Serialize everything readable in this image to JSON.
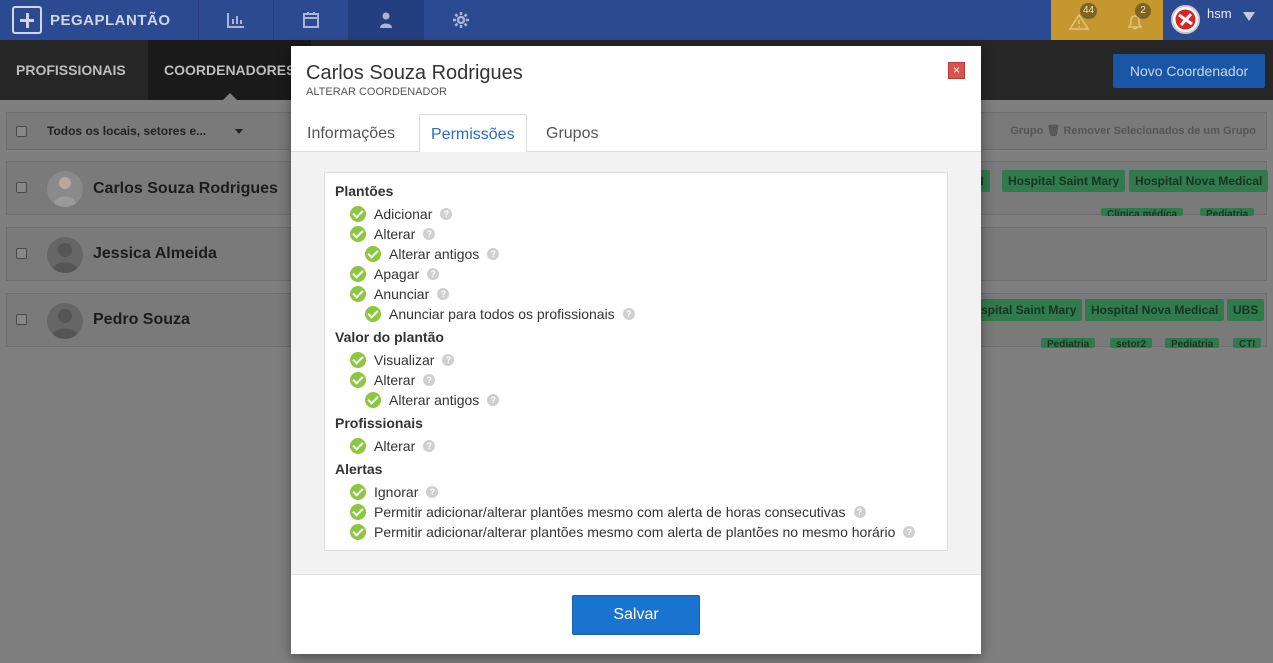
{
  "app": {
    "name": "PEGAPLANTÃO",
    "alerts": [
      {
        "count": "44"
      },
      {
        "count": "2"
      }
    ],
    "user": "hsm"
  },
  "subnav": {
    "tabs": [
      "PROFISSIONAIS",
      "COORDENADORES"
    ],
    "new_button": "Novo Coordenador"
  },
  "list": {
    "filter": "Todos os locais, setores e...",
    "actions": [
      "Grupo",
      "Remover Selecionados de um Grupo"
    ],
    "rows": [
      {
        "name": "Carlos Souza Rodrigues",
        "tags": [
          "TI",
          "Hospital Saint Mary",
          "Hospital Nova Medical"
        ],
        "subtags": [
          "Clínica médica",
          "Pediatria"
        ]
      },
      {
        "name": "Jessica Almeida",
        "tags": [],
        "subtags": []
      },
      {
        "name": "Pedro Souza",
        "tags": [
          "spital Saint Mary",
          "Hospital Nova Medical",
          "UBS"
        ],
        "subtags": [
          "Pediatria",
          "setor2",
          "Pediatria",
          "CTI"
        ]
      }
    ]
  },
  "modal": {
    "title": "Carlos Souza Rodrigues",
    "subtitle": "ALTERAR COORDENADOR",
    "close": "×",
    "tabs": [
      "Informações",
      "Permissões",
      "Grupos"
    ],
    "sections": [
      {
        "label": "Plantões",
        "items": [
          "Adicionar",
          "Alterar",
          "Alterar antigos",
          "Apagar",
          "Anunciar",
          "Anunciar para todos os profissionais"
        ]
      },
      {
        "label": "Valor do plantão",
        "items": [
          "Visualizar",
          "Alterar",
          "Alterar antigos"
        ]
      },
      {
        "label": "Profissionais",
        "items": [
          "Alterar"
        ]
      },
      {
        "label": "Alertas",
        "items": [
          "Ignorar",
          "Permitir adicionar/alterar plantões mesmo com alerta de horas consecutivas",
          "Permitir adicionar/alterar plantões mesmo com alerta de plantões no mesmo horário"
        ]
      }
    ],
    "help": "?",
    "save": "Salvar"
  },
  "colors": {
    "topbar": "#2c4a92",
    "accent": "#1a73d0",
    "check": "#8dc63f",
    "alert_bg": "#c4972f"
  },
  "icons": [
    "chart-icon",
    "calendar-icon",
    "user-icon",
    "gear-icon",
    "warning-icon",
    "bell-icon",
    "check-icon",
    "help-icon",
    "close-icon"
  ]
}
